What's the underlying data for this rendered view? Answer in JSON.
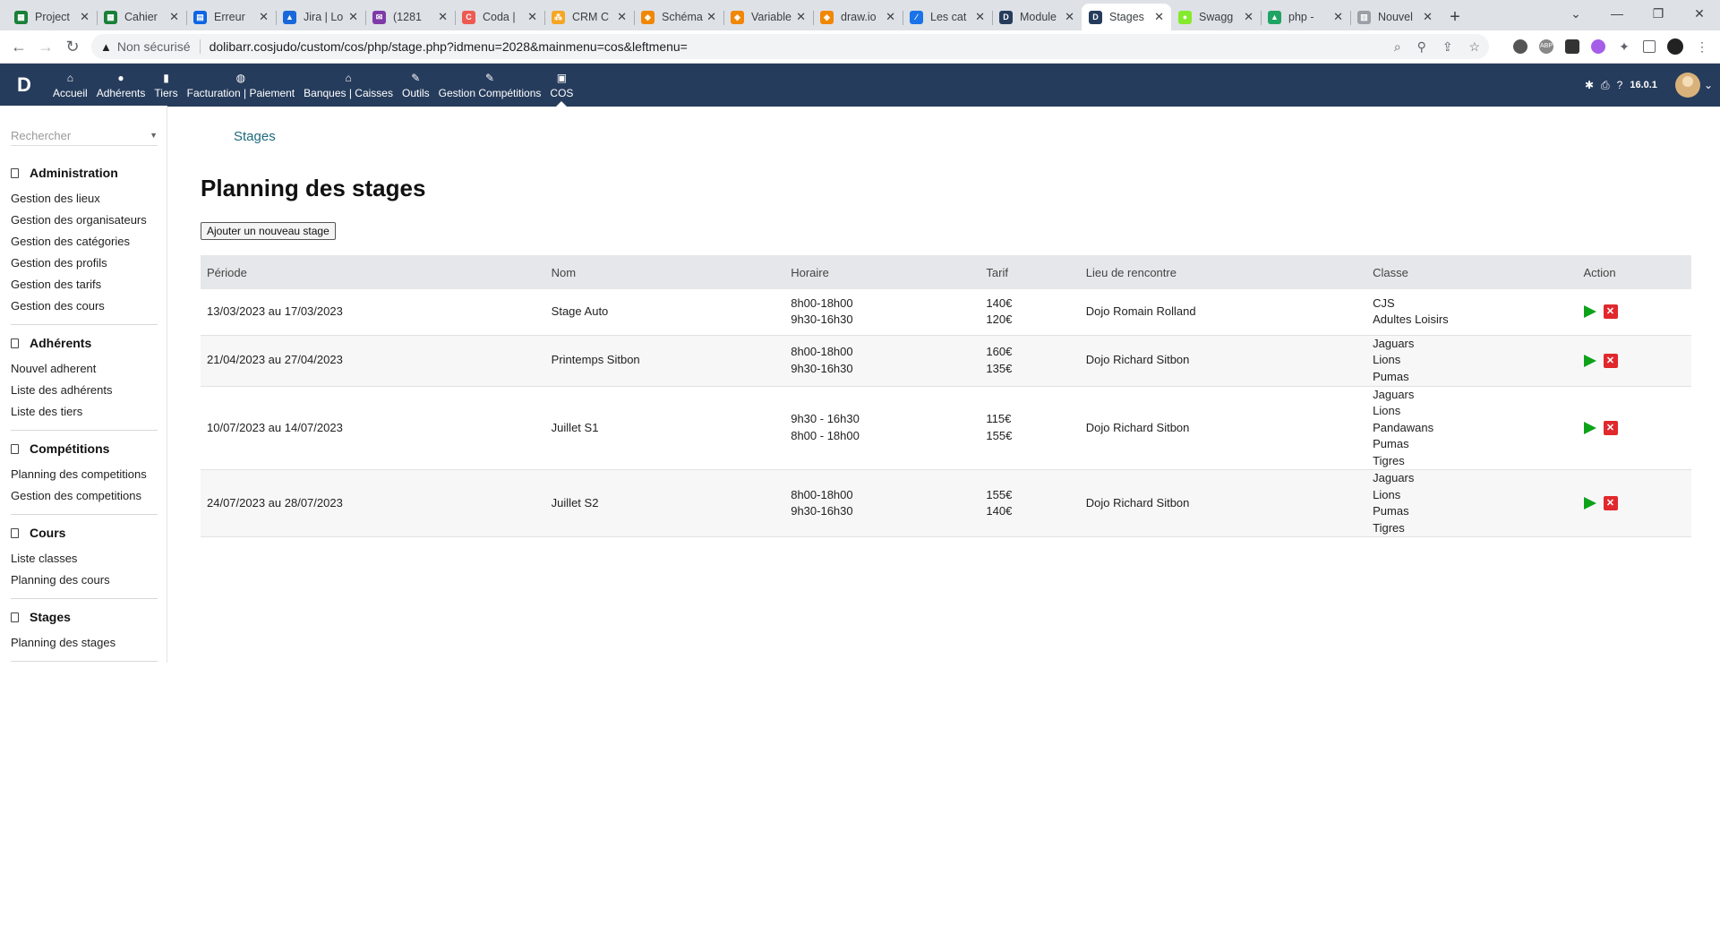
{
  "browser": {
    "tabs": [
      {
        "label": "Project",
        "color": "#188038",
        "glyph": "▦"
      },
      {
        "label": "Cahier",
        "color": "#188038",
        "glyph": "▦"
      },
      {
        "label": "Erreur",
        "color": "#0c66e4",
        "glyph": "▤"
      },
      {
        "label": "Jira | Lo",
        "color": "#1868db",
        "glyph": "▲"
      },
      {
        "label": "(1281",
        "color": "#7e3aa8",
        "glyph": "✉"
      },
      {
        "label": "Coda |",
        "color": "#ee5a52",
        "glyph": "C"
      },
      {
        "label": "CRM C",
        "color": "#f5a623",
        "glyph": "⁂"
      },
      {
        "label": "Schéma",
        "color": "#f08705",
        "glyph": "◈"
      },
      {
        "label": "Variable",
        "color": "#f08705",
        "glyph": "◈"
      },
      {
        "label": "draw.io",
        "color": "#f08705",
        "glyph": "◈"
      },
      {
        "label": "Les cat",
        "color": "#1a73e8",
        "glyph": "∕"
      },
      {
        "label": "Module",
        "color": "#263c5c",
        "glyph": "D"
      },
      {
        "label": "Stages",
        "color": "#263c5c",
        "glyph": "D",
        "active": true
      },
      {
        "label": "Swagg",
        "color": "#85ea2d",
        "glyph": "●"
      },
      {
        "label": "php -",
        "color": "#1fa463",
        "glyph": "▲"
      },
      {
        "label": "Nouvel",
        "color": "#9aa0a6",
        "glyph": "▥"
      }
    ],
    "new_tab": "+",
    "security": "Non sécurisé",
    "url": "dolibarr.cosjudo/custom/cos/php/stage.php?idmenu=2028&mainmenu=cos&leftmenu="
  },
  "topmenu": {
    "logo": "D",
    "items": [
      {
        "label": "Accueil",
        "icon": "⌂",
        "name": "home"
      },
      {
        "label": "Adhérents",
        "icon": "●",
        "name": "members"
      },
      {
        "label": "Tiers",
        "icon": "▮",
        "name": "thirdparties"
      },
      {
        "label": "Facturation | Paiement",
        "icon": "◍",
        "name": "billing"
      },
      {
        "label": "Banques | Caisses",
        "icon": "⌂",
        "name": "banks"
      },
      {
        "label": "Outils",
        "icon": "✎",
        "name": "tools"
      },
      {
        "label": "Gestion Compétitions",
        "icon": "✎",
        "name": "competitions"
      },
      {
        "label": "COS",
        "icon": "▣",
        "name": "cos",
        "active": true
      }
    ],
    "version": "16.0.1"
  },
  "sidebar": {
    "search_placeholder": "Rechercher",
    "sections": [
      {
        "title": "Administration",
        "links": [
          "Gestion des lieux",
          "Gestion des organisateurs",
          "Gestion des catégories",
          "Gestion des profils",
          "Gestion des tarifs",
          "Gestion des cours"
        ]
      },
      {
        "title": "Adhérents",
        "links": [
          "Nouvel adherent",
          "Liste des adhérents",
          "Liste des tiers"
        ]
      },
      {
        "title": "Compétitions",
        "links": [
          "Planning des competitions",
          "Gestion des competitions"
        ]
      },
      {
        "title": "Cours",
        "links": [
          "Liste classes",
          "Planning des cours"
        ]
      },
      {
        "title": "Stages",
        "links": [
          "Planning des stages"
        ]
      }
    ]
  },
  "main": {
    "breadcrumb": "Stages",
    "title": "Planning des stages",
    "add_button": "Ajouter un nouveau stage",
    "columns": [
      "Période",
      "Nom",
      "Horaire",
      "Tarif",
      "Lieu de rencontre",
      "Classe",
      "Action"
    ],
    "rows": [
      {
        "periode": "13/03/2023 au 17/03/2023",
        "nom": "Stage Auto",
        "horaire": [
          "8h00-18h00",
          "9h30-16h30"
        ],
        "tarif": [
          "140€",
          "120€"
        ],
        "lieu": "Dojo Romain Rolland",
        "classe": [
          "CJS",
          "Adultes Loisirs"
        ]
      },
      {
        "periode": "21/04/2023 au 27/04/2023",
        "nom": "Printemps Sitbon",
        "horaire": [
          "8h00-18h00",
          "9h30-16h30"
        ],
        "tarif": [
          "160€",
          "135€"
        ],
        "lieu": "Dojo Richard Sitbon",
        "classe": [
          "Jaguars",
          "Lions",
          "Pumas"
        ]
      },
      {
        "periode": "10/07/2023 au 14/07/2023",
        "nom": "Juillet S1",
        "horaire": [
          "9h30 - 16h30",
          "8h00 - 18h00"
        ],
        "tarif": [
          "115€",
          "155€"
        ],
        "lieu": "Dojo Richard Sitbon",
        "classe": [
          "Jaguars",
          "Lions",
          "Pandawans",
          "Pumas",
          "Tigres"
        ]
      },
      {
        "periode": "24/07/2023 au 28/07/2023",
        "nom": "Juillet S2",
        "horaire": [
          "8h00-18h00",
          "9h30-16h30"
        ],
        "tarif": [
          "155€",
          "140€"
        ],
        "lieu": "Dojo Richard Sitbon",
        "classe": [
          "Jaguars",
          "Lions",
          "Pumas",
          "Tigres"
        ]
      }
    ]
  }
}
